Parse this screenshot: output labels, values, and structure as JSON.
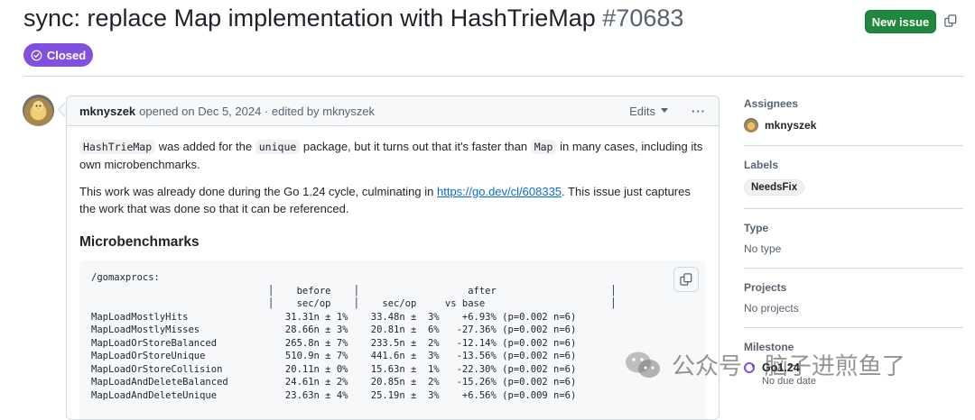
{
  "issue": {
    "title": "sync: replace Map implementation with HashTrieMap",
    "number": "#70683",
    "state": "Closed",
    "new_issue_label": "New issue",
    "state_color": "#8250df",
    "primary_color": "#1f883d"
  },
  "comment": {
    "author": "mknyszek",
    "meta_opened": "opened on Dec 5, 2024 · edited by mknyszek",
    "edits_label": "Edits",
    "more_label": "···",
    "p1": {
      "code1": "HashTrieMap",
      "t1": " was added for the ",
      "code2": "unique",
      "t2": " package, but it turns out that it's faster than ",
      "code3": "Map",
      "t3": " in many cases, including its own microbenchmarks."
    },
    "p2": {
      "t1": "This work was already done during the Go 1.24 cycle, culminating in ",
      "link": "https://go.dev/cl/608335",
      "t2": ". This issue just captures the work that was done so that it can be referenced."
    },
    "heading": "Microbenchmarks",
    "bench_header": [
      "/gomaxprocs:",
      "                               │    before    │                   after                    │",
      "                               │    sec/op    │    sec/op     vs base                      │"
    ],
    "bench_rows": [
      "MapLoadMostlyHits                 31.31n ± 1%    33.48n ±  3%    +6.93% (p=0.002 n=6)",
      "MapLoadMostlyMisses               28.66n ± 3%    20.81n ±  6%   -27.36% (p=0.002 n=6)",
      "MapLoadOrStoreBalanced            265.8n ± 7%    233.5n ±  2%   -12.14% (p=0.002 n=6)",
      "MapLoadOrStoreUnique              510.9n ± 7%    441.6n ±  3%   -13.56% (p=0.002 n=6)",
      "MapLoadOrStoreCollision           20.11n ± 0%    15.63n ±  1%   -22.30% (p=0.002 n=6)",
      "MapLoadAndDeleteBalanced          24.61n ± 2%    20.85n ±  2%   -15.26% (p=0.002 n=6)",
      "MapLoadAndDeleteUnique            23.63n ± 4%    25.19n ±  3%    +6.56% (p=0.009 n=6)"
    ]
  },
  "sidebar": {
    "assignees_title": "Assignees",
    "assignee": "mknyszek",
    "labels_title": "Labels",
    "label": "NeedsFix",
    "type_title": "Type",
    "type_value": "No type",
    "projects_title": "Projects",
    "projects_value": "No projects",
    "milestone_title": "Milestone",
    "milestone": "Go1.24",
    "milestone_due": "No due date"
  },
  "watermark": {
    "text": "公众号 · 脑子进煎鱼了"
  }
}
